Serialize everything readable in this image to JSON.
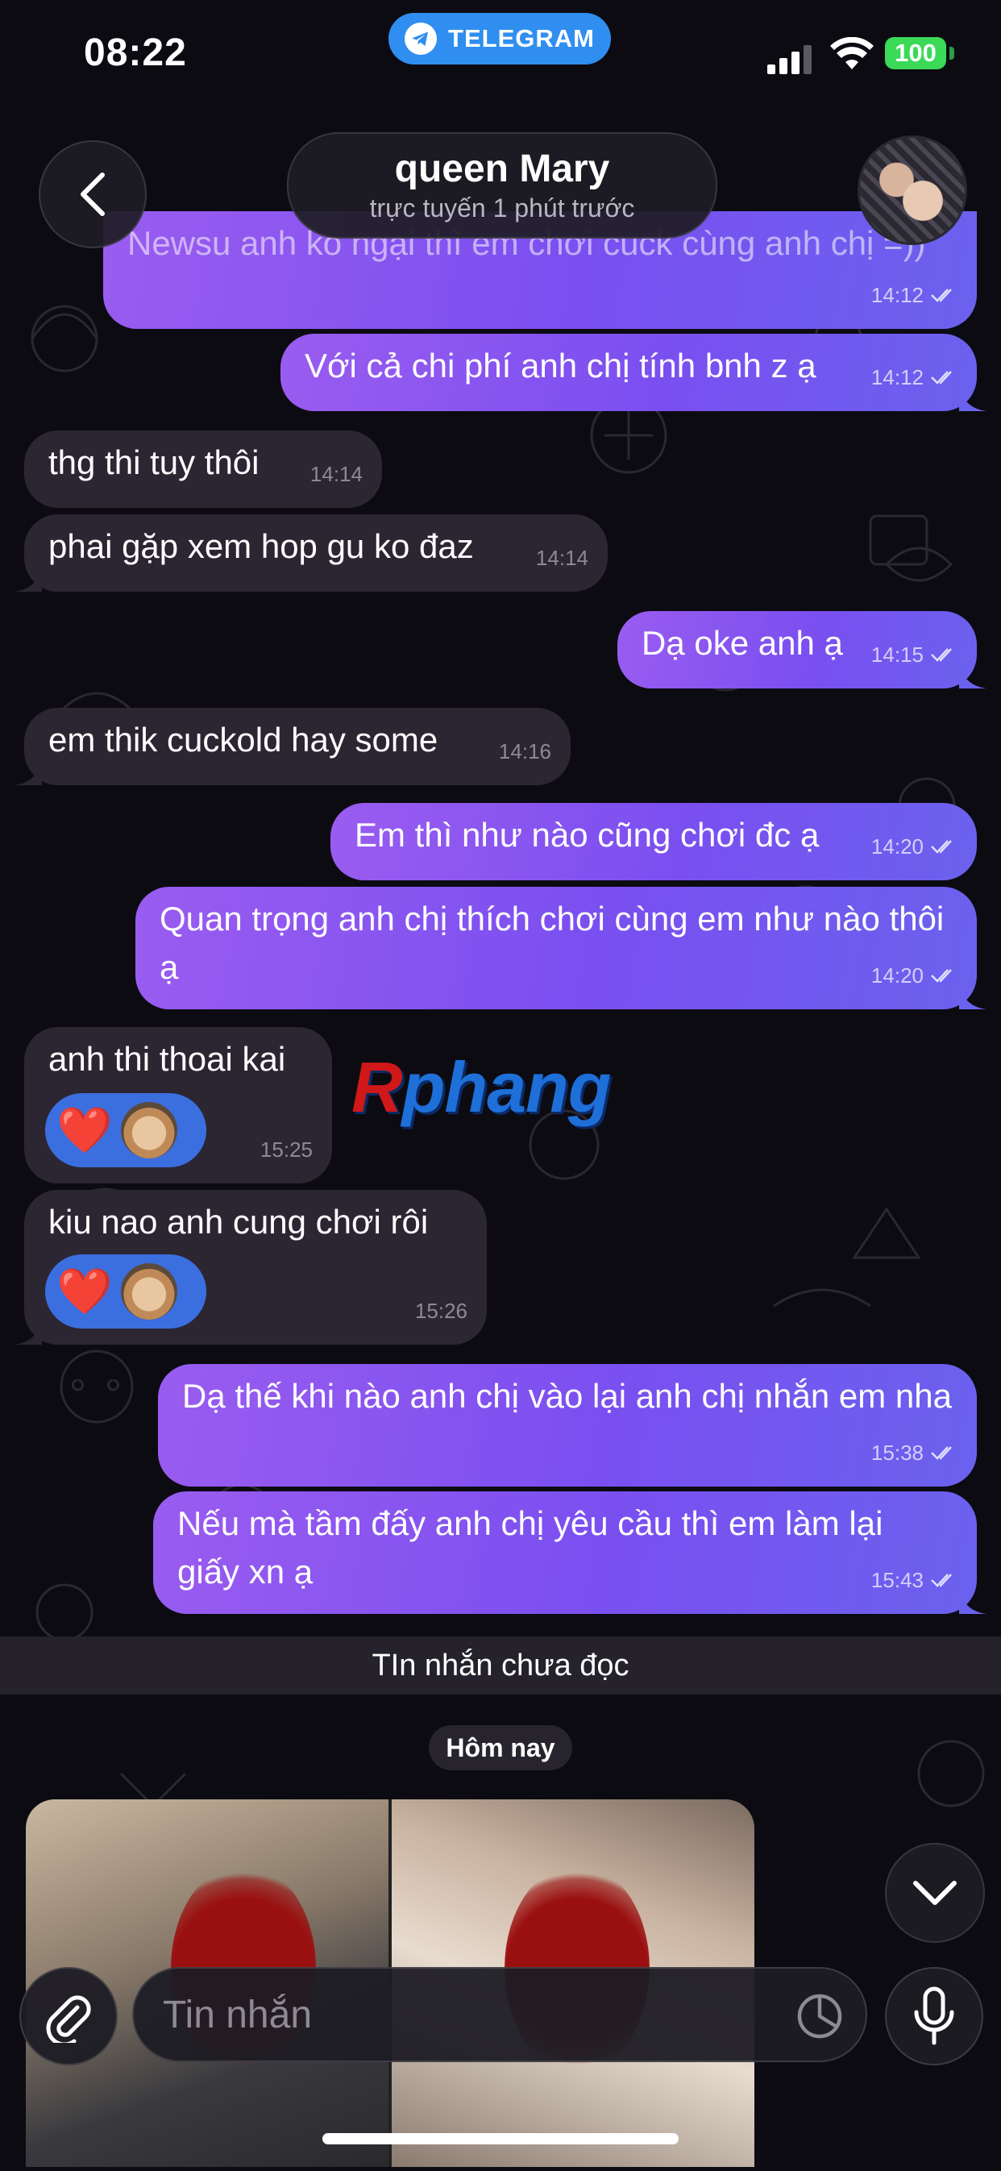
{
  "status_bar": {
    "time": "08:22",
    "app_pill": "TELEGRAM",
    "battery": "100"
  },
  "header": {
    "name": "queen Mary",
    "status": "trực tuyến 1 phút trước"
  },
  "messages": [
    {
      "dir": "out",
      "text": "Newsu anh ko ngại thì em chơi cuck cùng anh chị =))",
      "time": "14:12"
    },
    {
      "dir": "out",
      "text": "Với cả chi phí anh chị tính bnh z ạ",
      "time": "14:12"
    },
    {
      "dir": "in",
      "text": "thg thi tuy thôi",
      "time": "14:14"
    },
    {
      "dir": "in",
      "text": "phai gặp xem hop gu ko đaz",
      "time": "14:14"
    },
    {
      "dir": "out",
      "text": "Dạ oke anh ạ",
      "time": "14:15"
    },
    {
      "dir": "in",
      "text": "em thik cuckold hay some",
      "time": "14:16"
    },
    {
      "dir": "out",
      "text": "Em thì như nào cũng chơi đc ạ",
      "time": "14:20"
    },
    {
      "dir": "out",
      "text": "Quan trọng anh chị thích chơi cùng em như nào thôi ạ",
      "time": "14:20"
    },
    {
      "dir": "in",
      "text": "anh thi thoai kai",
      "time": "15:25",
      "reaction": "❤️"
    },
    {
      "dir": "in",
      "text": "kiu nao anh cung chơi rôi",
      "time": "15:26",
      "reaction": "❤️"
    },
    {
      "dir": "out",
      "text": "Dạ thế khi nào anh chị vào lại anh chị nhắn em nha",
      "time": "15:38"
    },
    {
      "dir": "out",
      "text": "Nếu mà tầm đấy anh chị yêu cầu thì em làm lại giấy xn ạ",
      "time": "15:43"
    }
  ],
  "watermark": {
    "prefix": "R",
    "rest": "phang"
  },
  "unread_label": "TIn nhắn chưa đọc",
  "date_label": "Hôm nay",
  "composer": {
    "placeholder": "Tin nhắn"
  },
  "colors": {
    "outgoing": "#8a55f0",
    "incoming": "#2c2633",
    "reaction": "#3b6fe0",
    "accent": "#2f8ef0"
  }
}
